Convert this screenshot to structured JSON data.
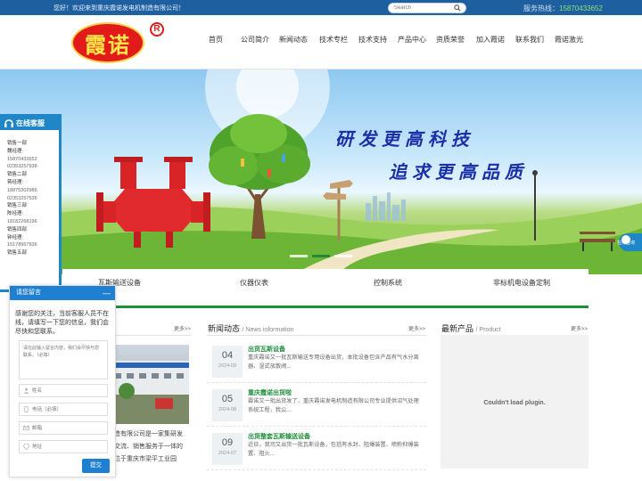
{
  "topbar": {
    "welcome": "您好！欢迎来到重庆霞诺发电机制造有限公司！",
    "search_placeholder": "Search",
    "hotline_label": "服务热线：",
    "hotline_number": "15870433652"
  },
  "logo": {
    "text": "霞诺",
    "mark": "R"
  },
  "nav": [
    "首页",
    "公司简介",
    "新闻动态",
    "技术专栏",
    "技术支持",
    "产品中心",
    "资质荣誉",
    "加入霞诺",
    "联系我们",
    "霞诺激光"
  ],
  "banner": {
    "slogan_line1": "研发更高科技",
    "slogan_line2": "追求更高品质"
  },
  "categories": [
    "瓦斯输送设备",
    "仪器仪表",
    "控制系统",
    "非标机电设备定制"
  ],
  "online_service": {
    "title": "在线客服",
    "lines": [
      "销售一部",
      "魏经理:",
      "15870433652",
      "02353257938",
      "销售二部",
      "蒋经理:",
      "18875302986",
      "02353257535",
      "销售三部",
      "陈经理:",
      "18182268196",
      "销售四部",
      "钟经理:",
      "15178967836",
      "销售五部"
    ]
  },
  "float_consult": {
    "label": "在线咨询"
  },
  "about": {
    "more": "更多>>",
    "text_lines": [
      "造有限公司是一家集研发",
      "交流、销售服务于一体的",
      "位于重庆市梁平工业园"
    ]
  },
  "news": {
    "title": "新闻动态",
    "subtitle": "/ News information",
    "more": "更多>>",
    "items": [
      {
        "day": "04",
        "ym": "2024-09",
        "title": "出货瓦斯设备",
        "desc": "重庆霞诺又一批瓦斯输送专用设备出货，本批设备包含产品有气水分离器、湿式放散阀..."
      },
      {
        "day": "05",
        "ym": "2024-08",
        "title": "重庆霞诺出货啦",
        "desc": "霞诺又一批出货发了，重庆霞诺发电机制造有限公司专业提供沼气处理系统工程，我公..."
      },
      {
        "day": "09",
        "ym": "2024-07",
        "title": "出货整套瓦斯输送设备",
        "desc": "近日，我司又出货一批瓦斯设备，包括有水封、阻爆装置、喷粉抑爆装置、阻火..."
      }
    ]
  },
  "products": {
    "title": "最新产品",
    "subtitle": "/ Product",
    "more": "更多>>",
    "plugin_msg": "Couldn't load plugin."
  },
  "message_form": {
    "title": "请您留言",
    "minimize": "—",
    "intro": "感谢您的关注，当前客服人员不在线，请填写一下您的信息，我们会尽快和您联系。",
    "content_placeholder": "请在此输入留言内容，我们会尽快与您联系。（必填）",
    "name_placeholder": "姓名",
    "phone_placeholder": "电话（必填）",
    "email_placeholder": "邮箱",
    "address_placeholder": "地址",
    "submit_label": "提交"
  }
}
